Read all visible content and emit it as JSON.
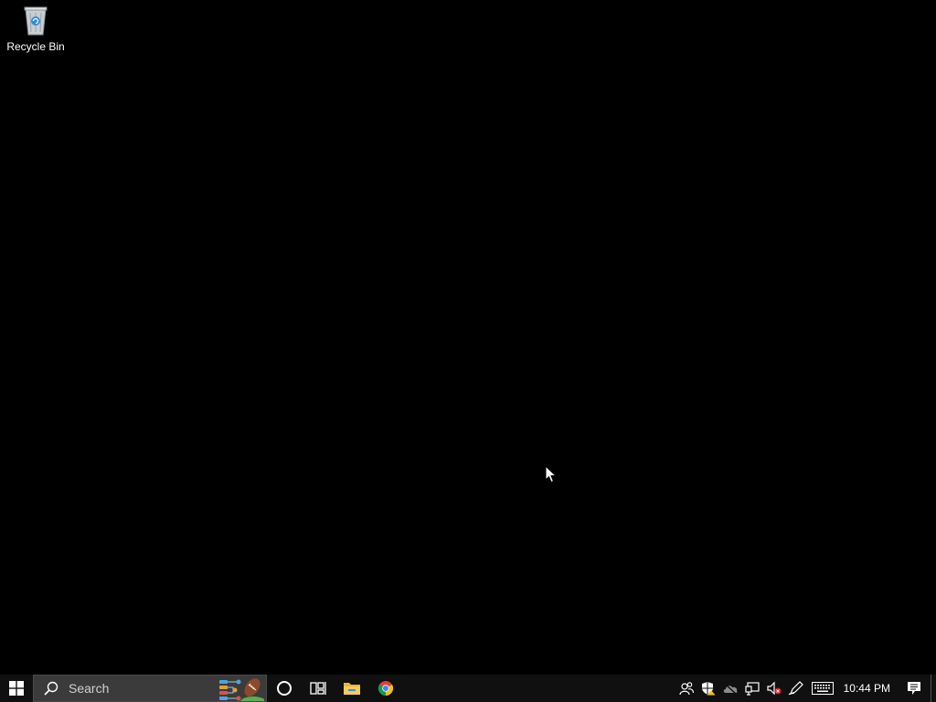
{
  "desktop": {
    "background_color": "#000000",
    "icons": [
      {
        "label": "Recycle Bin",
        "icon": "recycle-bin-icon"
      }
    ]
  },
  "taskbar": {
    "background_color": "#101010",
    "start_icon": "windows-logo-icon",
    "search": {
      "placeholder": "Search",
      "icon": "search-icon",
      "highlight_icon": "search-highlight-football-icon"
    },
    "pinned": [
      {
        "name": "Cortana",
        "icon": "cortana-circle-icon"
      },
      {
        "name": "Task View",
        "icon": "task-view-icon"
      },
      {
        "name": "File Explorer",
        "icon": "file-explorer-icon"
      },
      {
        "name": "Google Chrome",
        "icon": "chrome-icon"
      }
    ],
    "tray": {
      "icons": [
        "people-icon",
        "security-shield-icon",
        "onedrive-cloud-icon",
        "network-icon",
        "volume-muted-icon",
        "pen-workspace-icon",
        "touch-keyboard-icon"
      ],
      "clock": "10:44 PM",
      "notification_icon": "action-center-icon"
    }
  }
}
